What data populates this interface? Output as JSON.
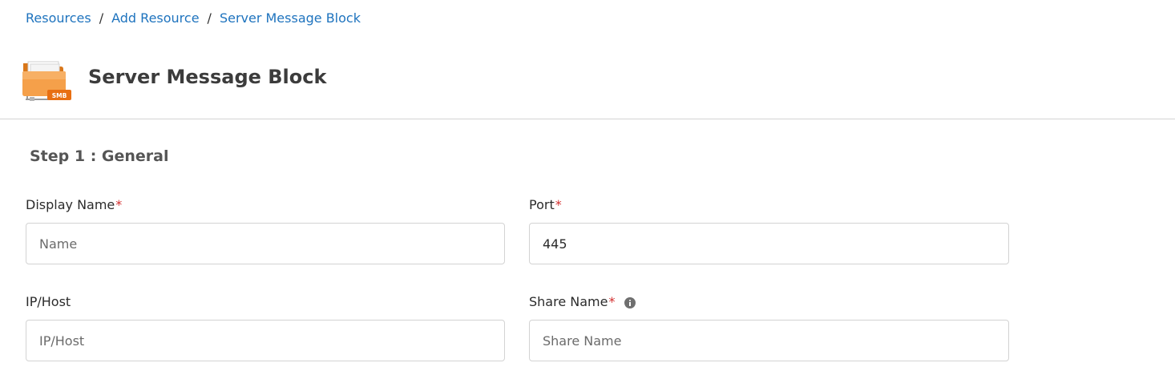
{
  "breadcrumb": {
    "items": [
      "Resources",
      "Add Resource",
      "Server Message Block"
    ],
    "separator": "/"
  },
  "header": {
    "title": "Server Message Block",
    "icon_name": "smb-folder-icon",
    "icon_badge": "SMB",
    "accent_color": "#f08a24"
  },
  "step": {
    "title": "Step 1 : General"
  },
  "form": {
    "display_name": {
      "label": "Display Name",
      "required_mark": "*",
      "value": "",
      "placeholder": "Name"
    },
    "port": {
      "label": "Port",
      "required_mark": "*",
      "value": "445",
      "placeholder": ""
    },
    "ip_host": {
      "label": "IP/Host",
      "value": "",
      "placeholder": "IP/Host"
    },
    "share_name": {
      "label": "Share Name",
      "required_mark": "*",
      "value": "",
      "placeholder": "Share Name",
      "info_icon": "info-icon"
    }
  },
  "colors": {
    "link": "#1e73be",
    "required": "#d32f2f",
    "border": "#d3d3d3"
  }
}
